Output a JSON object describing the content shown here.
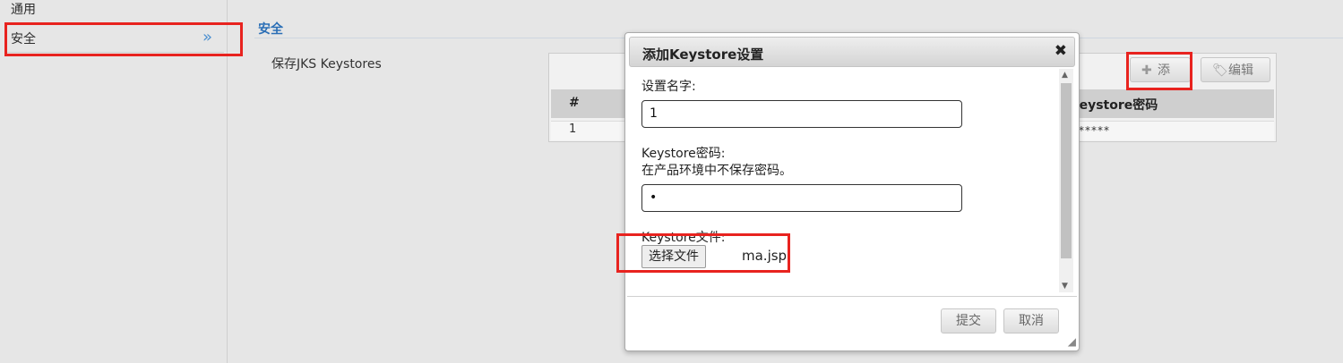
{
  "sidebar": {
    "items": [
      {
        "label": "通用"
      },
      {
        "label": "安全",
        "chevron": "»"
      }
    ]
  },
  "section": {
    "title": "安全",
    "field_label": "保存JKS Keystores"
  },
  "grid": {
    "toolbar": {
      "add_label": "添加",
      "add_icon": "plus-icon",
      "edit_label": "编辑",
      "edit_icon": "tag-icon"
    },
    "columns": [
      "#",
      "Keystore密码"
    ],
    "rows": [
      {
        "index": "1",
        "password": "******"
      }
    ]
  },
  "dialog": {
    "title": "添加Keystore设置",
    "close": "✖",
    "name_label": "设置名字:",
    "name_value": "1",
    "password_label": "Keystore密码:",
    "password_hint": "在产品环境中不保存密码。",
    "password_value": "•",
    "file_label": "Keystore文件:",
    "file_button": "选择文件",
    "file_name": "ma.jsp",
    "submit_label": "提交",
    "cancel_label": "取消"
  },
  "colors": {
    "highlight_box": "#e8231f",
    "section_title": "#2b6fb6",
    "chevron": "#4a8fd0"
  }
}
